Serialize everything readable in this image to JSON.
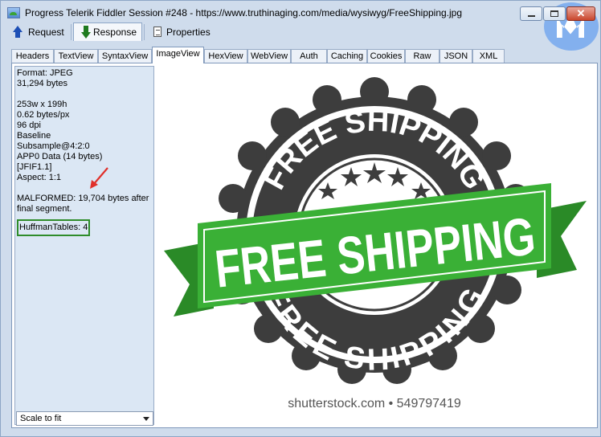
{
  "window": {
    "title": "Progress Telerik Fiddler Session #248 - https://www.truthinaging.com/media/wysiwyg/FreeShipping.jpg"
  },
  "top_tabs": [
    {
      "label": "Request",
      "icon": "up-arrow-icon"
    },
    {
      "label": "Response",
      "icon": "down-arrow-icon",
      "active": true
    },
    {
      "label": "Properties",
      "icon": "document-icon"
    }
  ],
  "sub_tabs": [
    "Headers",
    "TextView",
    "SyntaxView",
    "ImageView",
    "HexView",
    "WebView",
    "Auth",
    "Caching",
    "Cookies",
    "Raw",
    "JSON",
    "XML"
  ],
  "active_sub_tab": "ImageView",
  "info": {
    "format": "Format: JPEG",
    "size": "31,294 bytes",
    "dimensions": "253w x 199h",
    "bytes_per_px": "0.62 bytes/px",
    "dpi": "96 dpi",
    "encoding": "Baseline",
    "subsample": "Subsample@4:2:0",
    "app0": "APP0 Data (14 bytes)",
    "jfif": "[JFIF1.1]",
    "aspect": "Aspect: 1:1",
    "malformed": "MALFORMED: 19,704 bytes after final segment.",
    "huffman": "HuffmanTables: 4"
  },
  "scale_select": {
    "value": "Scale to fit"
  },
  "image": {
    "top_arc_text": "FREE SHIPPING",
    "banner_text": "FREE SHIPPING",
    "bottom_arc_text": "FREE SHIPPING",
    "credit": "shutterstock.com • 549797419"
  },
  "colors": {
    "seal_dark": "#3d3d3d",
    "banner_green": "#3ab036",
    "highlight_box": "#2e8c2a",
    "arrow": "#e0302a"
  }
}
